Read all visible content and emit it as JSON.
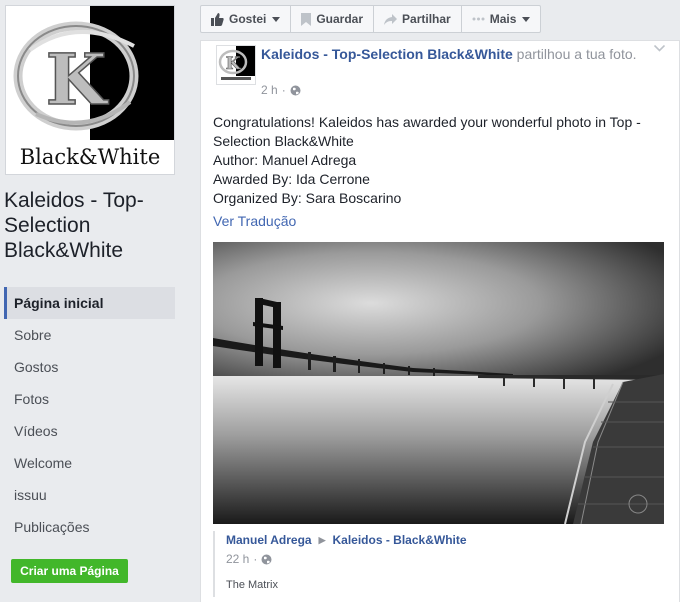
{
  "page": {
    "logo_text": "Black&White",
    "name": "Kaleidos - Top-Selection Black&White"
  },
  "nav": [
    {
      "label": "Página inicial",
      "active": true
    },
    {
      "label": "Sobre"
    },
    {
      "label": "Gostos"
    },
    {
      "label": "Fotos"
    },
    {
      "label": "Vídeos"
    },
    {
      "label": "Welcome"
    },
    {
      "label": "issuu"
    },
    {
      "label": "Publicações"
    }
  ],
  "create_page_label": "Criar uma Página",
  "actions": {
    "like": "Gostei",
    "save": "Guardar",
    "share": "Partilhar",
    "more": "Mais"
  },
  "post": {
    "author": "Kaleidos - Top-Selection Black&White",
    "action_text": "partilhou a tua foto.",
    "time": "2 h",
    "lines": [
      "Congratulations! Kaleidos has awarded your wonderful photo in Top -",
      "Selection Black&White",
      "Author: Manuel Adrega",
      "Awarded By: Ida Cerrone",
      "Organized By: Sara Boscarino"
    ],
    "translate_label": "Ver Tradução"
  },
  "shared": {
    "original_author": "Manuel Adrega",
    "target": "Kaleidos - Black&White",
    "time": "22 h",
    "caption": "The Matrix"
  },
  "colors": {
    "link": "#365899",
    "accent": "#4267b2",
    "create_button": "#42b72a"
  }
}
